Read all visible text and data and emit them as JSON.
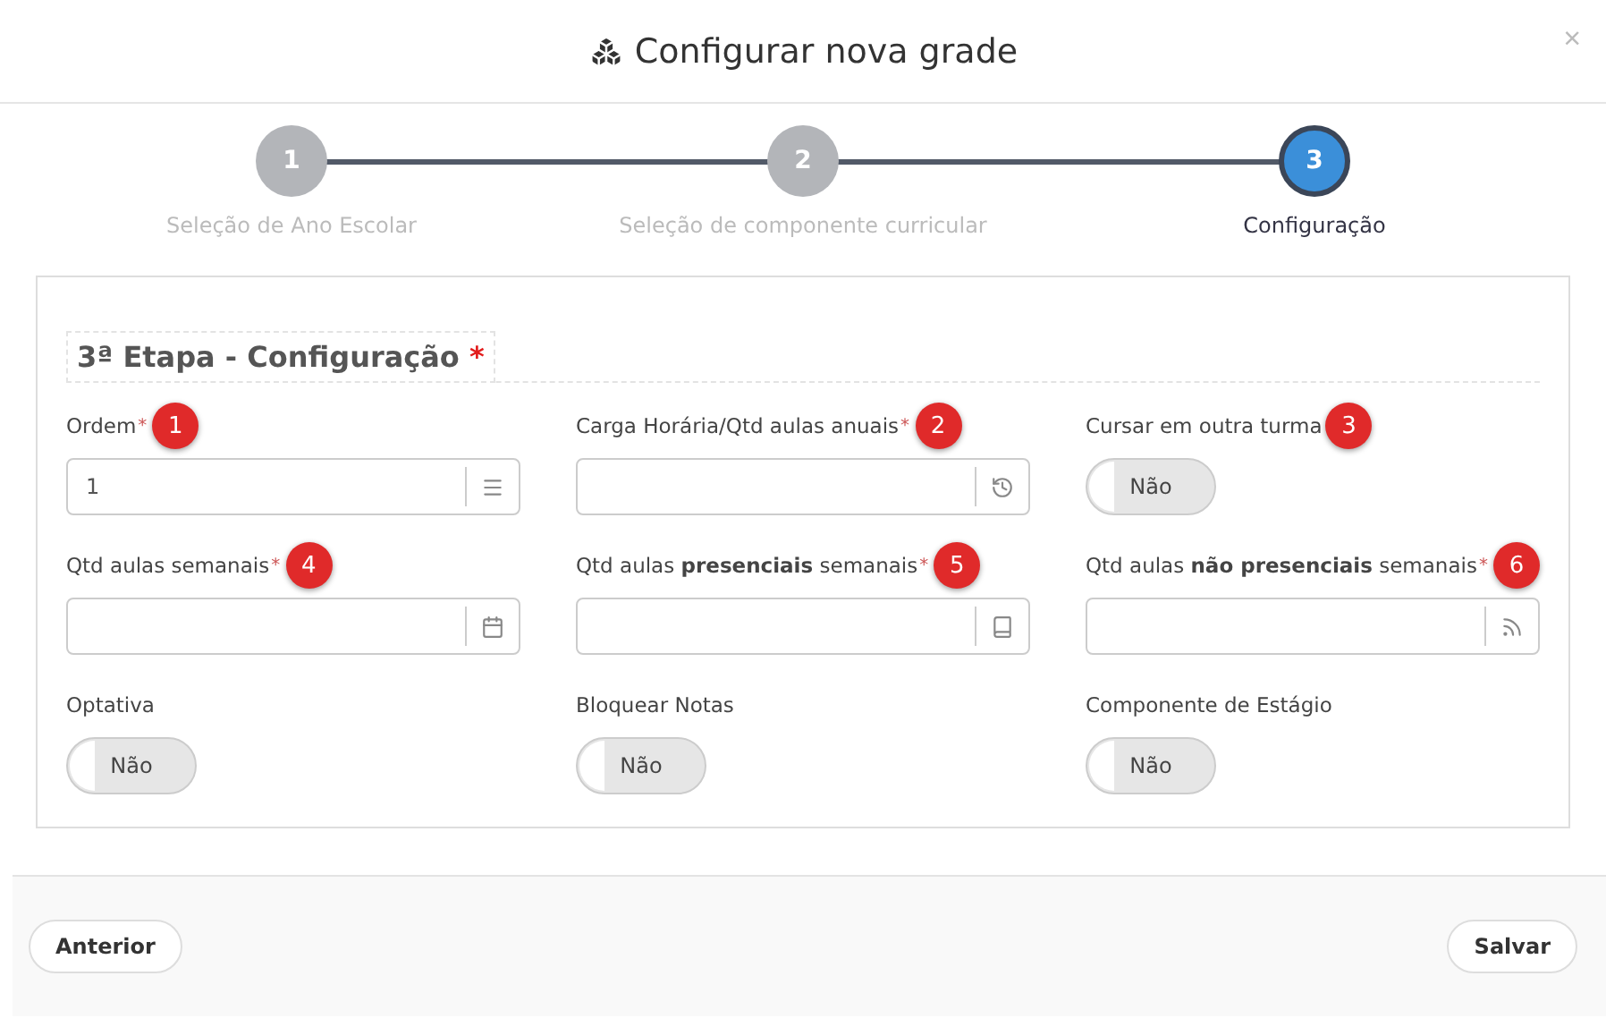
{
  "dialog": {
    "title": "Configurar nova grade",
    "close": "×"
  },
  "steps": [
    {
      "number": "1",
      "label": "Seleção de Ano Escolar",
      "selected": false
    },
    {
      "number": "2",
      "label": "Seleção de componente curricular",
      "selected": false
    },
    {
      "number": "3",
      "label": "Configuração",
      "selected": true
    }
  ],
  "section": {
    "title": "3ª Etapa - Configuração",
    "required_mark": "*"
  },
  "fields": [
    {
      "kind": "input",
      "label": "Ordem",
      "required": true,
      "badge": "1",
      "value": "1"
    },
    {
      "kind": "input",
      "label": "Carga Horária/Qtd aulas anuais",
      "required": true,
      "badge": "2"
    },
    {
      "kind": "toggle",
      "label": "Cursar em outra turma",
      "badge": "3",
      "on": false,
      "state_label": "Não"
    },
    {
      "kind": "input",
      "label": "Qtd aulas semanais",
      "required": true,
      "badge": "4"
    },
    {
      "kind": "input",
      "label": "Qtd aulas **presenciais** semanais",
      "required": true,
      "badge": "5"
    },
    {
      "kind": "input",
      "label": "Qtd aulas **não presenciais** semanais",
      "required": true,
      "badge": "6"
    },
    {
      "kind": "toggle",
      "label": "Optativa",
      "on": false,
      "state_label": "Não"
    },
    {
      "kind": "toggle",
      "label": "Bloquear Notas",
      "on": false,
      "state_label": "Não"
    },
    {
      "kind": "toggle",
      "label": "Componente de Estágio",
      "on": false,
      "state_label": "Não"
    }
  ],
  "footer": {
    "back": "Anterior",
    "save": "Salvar"
  }
}
